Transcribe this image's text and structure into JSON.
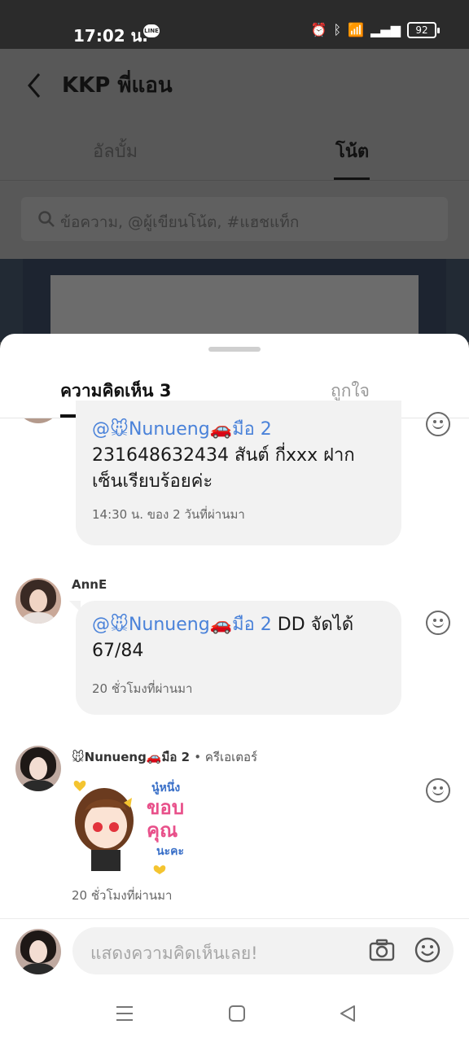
{
  "status_bar": {
    "time": "17:02 น.",
    "app_badge": "LINE",
    "battery": "92"
  },
  "header": {
    "title": "KKP พี่แอน"
  },
  "tabs": {
    "album": "อัลบั้ม",
    "note": "โน้ต"
  },
  "search": {
    "placeholder": "ข้อความ, @ผู้เขียนโน้ต, #แฮชแท็ก"
  },
  "sheet": {
    "tab_comments": "ความคิดเห็น 3",
    "tab_likes": "ถูกใจ"
  },
  "comments": [
    {
      "mention": "@🐭Nunueng🚗มือ 2",
      "text": "231648632434 สันต์ กี่xxx ฝากเซ็นเรียบร้อยค่ะ",
      "time": "14:30 น. ของ 2 วันที่ผ่านมา"
    },
    {
      "user": "AnnE",
      "mention": "@🐭Nunueng🚗มือ 2",
      "text": " DD  จัดได้ 67/84",
      "time": "20 ชั่วโมงที่ผ่านมา"
    },
    {
      "user": "🐭Nunueng🚗มือ 2",
      "role": "• ครีเอเตอร์",
      "sticker_text": [
        "นู๋หนึ่ง",
        "ขอบ",
        "คุณ",
        "นะคะ"
      ],
      "time": "20 ชั่วโมงที่ผ่านมา"
    }
  ],
  "input": {
    "placeholder": "แสดงความคิดเห็นเลย!"
  },
  "colors": {
    "mention": "#4a82d9",
    "sticker_pink": "#e8508a"
  }
}
